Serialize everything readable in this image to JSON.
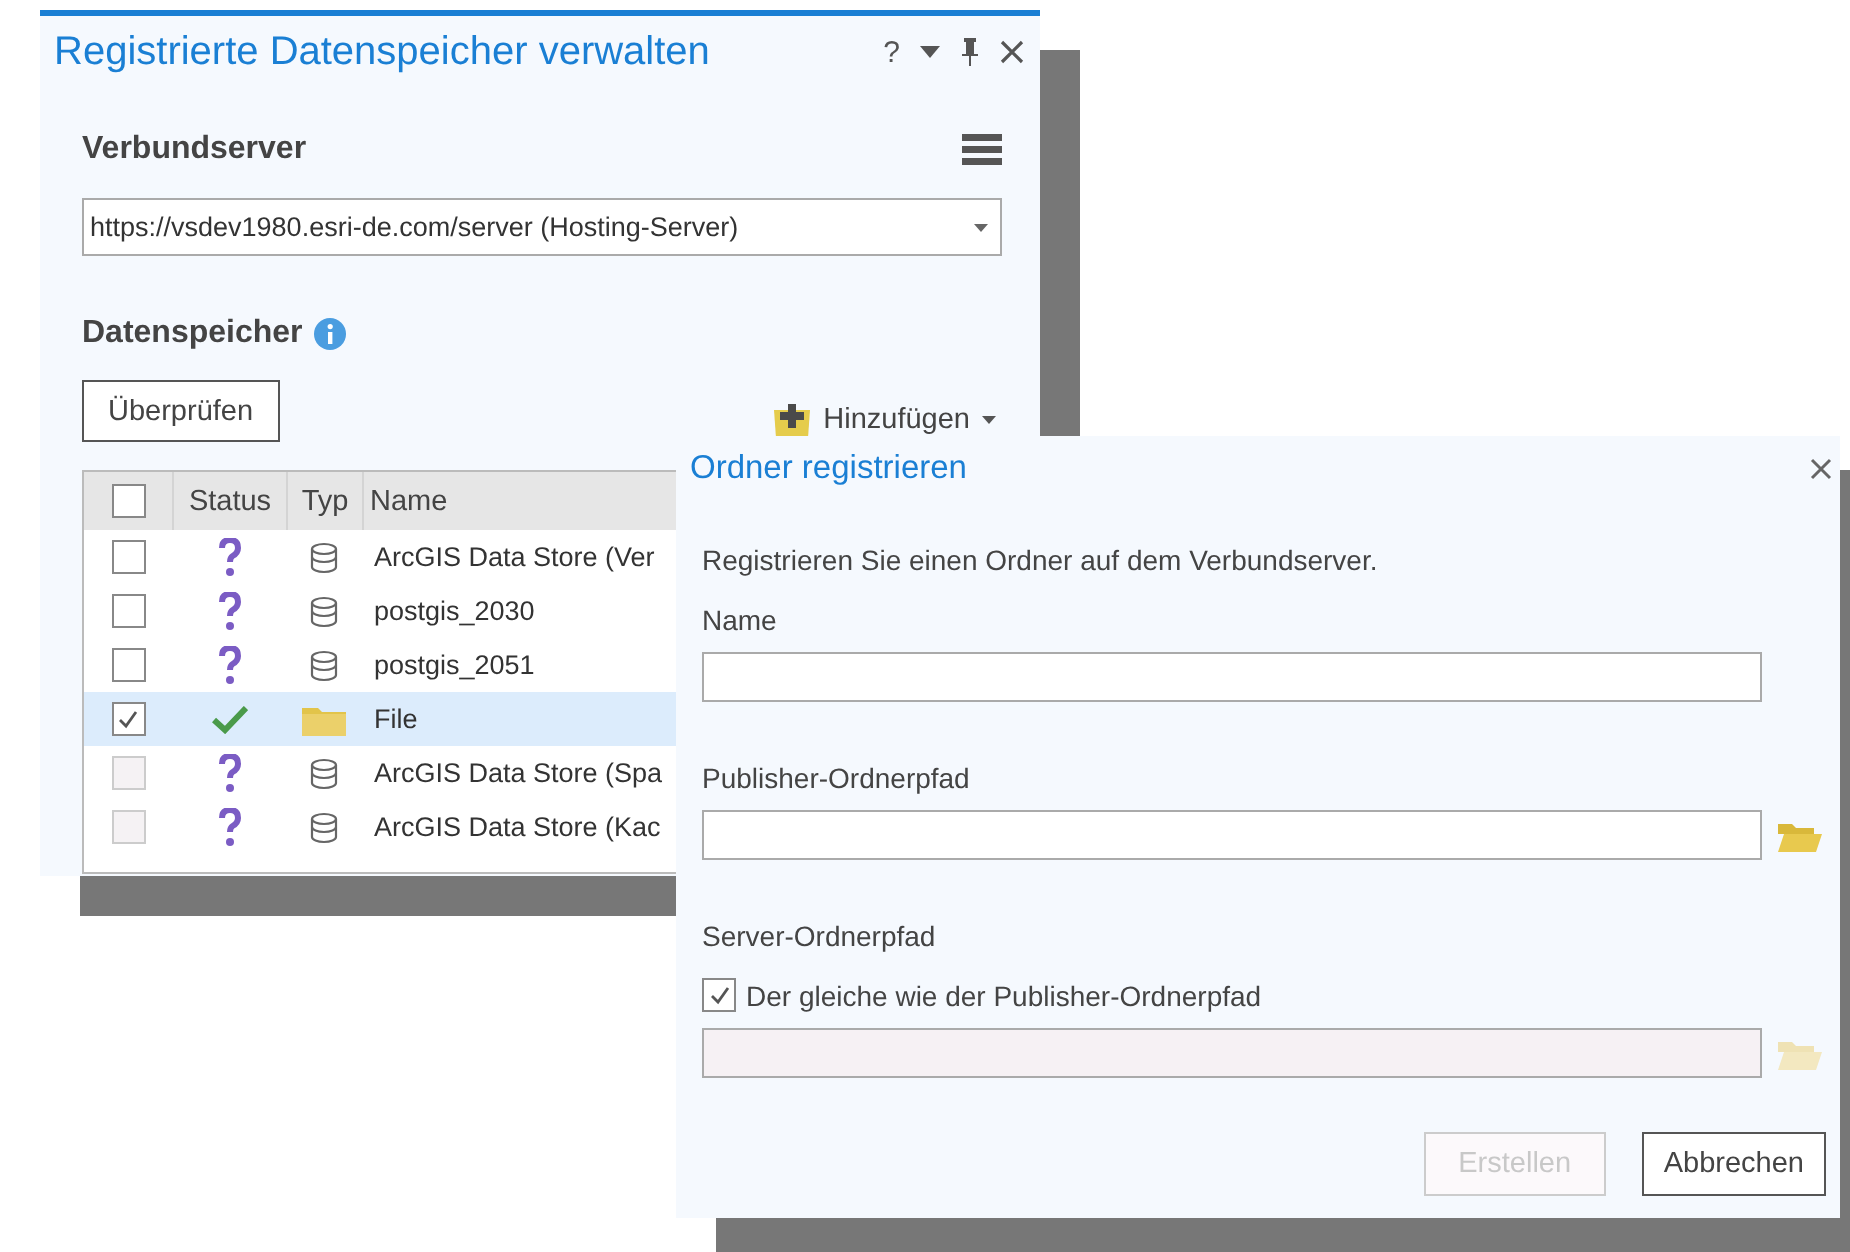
{
  "panel": {
    "title": "Registrierte Datenspeicher verwalten",
    "help": "?",
    "server_section": {
      "label": "Verbundserver",
      "value": "https://vsdev1980.esri-de.com/server (Hosting-Server)"
    },
    "stores_section": {
      "label": "Datenspeicher",
      "check_button": "Überprüfen",
      "add_button": "Hinzufügen"
    },
    "table": {
      "select_all_checked": false,
      "columns": [
        "Status",
        "Typ",
        "Name"
      ],
      "rows": [
        {
          "checked": false,
          "disabled": false,
          "selected": false,
          "verified": false,
          "folder": false,
          "name": "ArcGIS Data Store (Ver"
        },
        {
          "checked": false,
          "disabled": false,
          "selected": false,
          "verified": false,
          "folder": false,
          "name": "postgis_2030"
        },
        {
          "checked": false,
          "disabled": false,
          "selected": false,
          "verified": false,
          "folder": false,
          "name": "postgis_2051"
        },
        {
          "checked": true,
          "disabled": false,
          "selected": true,
          "verified": true,
          "folder": true,
          "name": "File"
        },
        {
          "checked": false,
          "disabled": true,
          "selected": false,
          "verified": false,
          "folder": false,
          "name": "ArcGIS Data Store (Spa"
        },
        {
          "checked": false,
          "disabled": true,
          "selected": false,
          "verified": false,
          "folder": false,
          "name": "ArcGIS Data Store (Kac"
        }
      ]
    }
  },
  "dialog": {
    "title": "Ordner registrieren",
    "description": "Registrieren Sie einen Ordner auf dem Verbundserver.",
    "name_field": {
      "label": "Name"
    },
    "publisher_path": {
      "label": "Publisher-Ordnerpfad"
    },
    "server_path": {
      "label": "Server-Ordnerpfad",
      "disabled": true,
      "same_as_publisher": {
        "label": "Der gleiche wie der Publisher-Ordnerpfad",
        "checked": true
      }
    },
    "buttons": [
      {
        "label": "Erstellen",
        "disabled": true
      },
      {
        "label": "Abbrechen",
        "disabled": false
      }
    ]
  }
}
